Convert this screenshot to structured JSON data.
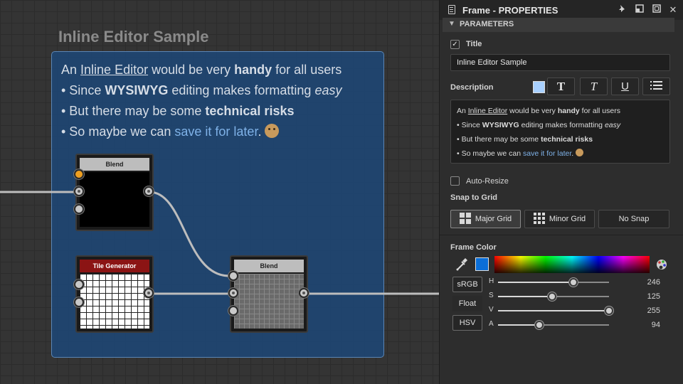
{
  "canvas": {
    "frame_title": "Inline Editor Sample",
    "frame_text": {
      "line1": {
        "pre": "An ",
        "link": "Inline Editor",
        "mid": " would be very ",
        "bold": "handy",
        "post": " for all users"
      },
      "line2": {
        "pre": "• Since ",
        "bold": "WYSIWYG",
        "mid": " editing makes formatting ",
        "italic": "easy"
      },
      "line3": {
        "pre": "• But there may be some ",
        "bold": "technical risks"
      },
      "line4": {
        "pre": "• So maybe we can ",
        "link": "save it for later",
        "post": "."
      }
    },
    "nodes": {
      "blend_top": "Blend",
      "tile_generator": "Tile Generator",
      "blend_bottom": "Blend"
    }
  },
  "panel": {
    "title": "Frame - PROPERTIES",
    "section": "PARAMETERS",
    "title_label": "Title",
    "title_checked": true,
    "title_value": "Inline Editor Sample",
    "description_label": "Description",
    "format_buttons": [
      "T",
      "T",
      "U"
    ],
    "description": {
      "line1": {
        "pre": "An ",
        "link": "Inline Editor",
        "mid": " would be very ",
        "bold": "handy",
        "post": " for all users"
      },
      "line2": {
        "pre": "• Since ",
        "bold": "WYSIWYG",
        "mid": " editing makes formatting ",
        "italic": "easy"
      },
      "line3": {
        "pre": "• But there may be some ",
        "bold": "technical risks"
      },
      "line4": {
        "pre": "• So maybe we can ",
        "link": "save it for later",
        "post": "."
      }
    },
    "auto_resize_label": "Auto-Resize",
    "auto_resize_checked": false,
    "snap_label": "Snap to Grid",
    "snap_options": [
      "Major Grid",
      "Minor Grid",
      "No Snap"
    ],
    "snap_selected": "Major Grid",
    "frame_color_label": "Frame Color",
    "frame_color_hex": "#0a6ed8",
    "modes": [
      "sRGB",
      "Float",
      "HSV"
    ],
    "channels": [
      {
        "name": "H",
        "value": "246",
        "fraction": 0.68
      },
      {
        "name": "S",
        "value": "125",
        "fraction": 0.49
      },
      {
        "name": "V",
        "value": "255",
        "fraction": 1.0
      },
      {
        "name": "A",
        "value": "94",
        "fraction": 0.37
      }
    ]
  }
}
